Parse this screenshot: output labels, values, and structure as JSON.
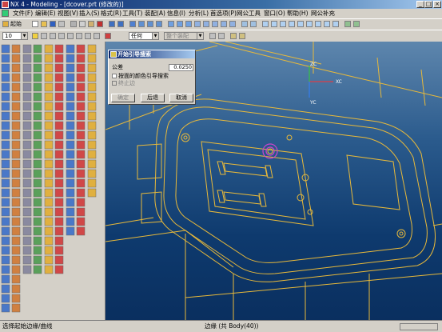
{
  "window": {
    "title": "NX 4 - Modeling - [dcover.prt (修改的)]",
    "min": "_",
    "max": "□",
    "close": "×"
  },
  "menu": [
    "文件(F)",
    "编辑(E)",
    "视图(V)",
    "插入(S)",
    "格式(R)",
    "工具(T)",
    "装配(A)",
    "信息(I)",
    "分析(L)",
    "首选项(P)",
    "网公工具",
    "窗口(O)",
    "帮助(H)",
    "网公补充"
  ],
  "toolbar": {
    "start_label": "起始",
    "layer_value": "10",
    "filter_value": "任何",
    "assembly_filter": "整个装配"
  },
  "dialog": {
    "title": "开始引导搜索",
    "tolerance_label": "公差",
    "tolerance_value": "0.0250",
    "option1": "按面的颜色引导搜索",
    "option2": "终止边",
    "ok": "确定",
    "back": "后退",
    "cancel": "取消"
  },
  "axis": {
    "zc": "ZC",
    "xc": "XC",
    "yc": "YC"
  },
  "status": {
    "left": "选择起始边缘/曲线",
    "center": "边缘 (共 Body(40))"
  },
  "colors": {
    "titlebar": "#0a246a",
    "geometry": "#e8b93a",
    "highlight": "#cc44cc",
    "background_top": "#5e86ad",
    "background_bottom": "#0a2f5f"
  }
}
